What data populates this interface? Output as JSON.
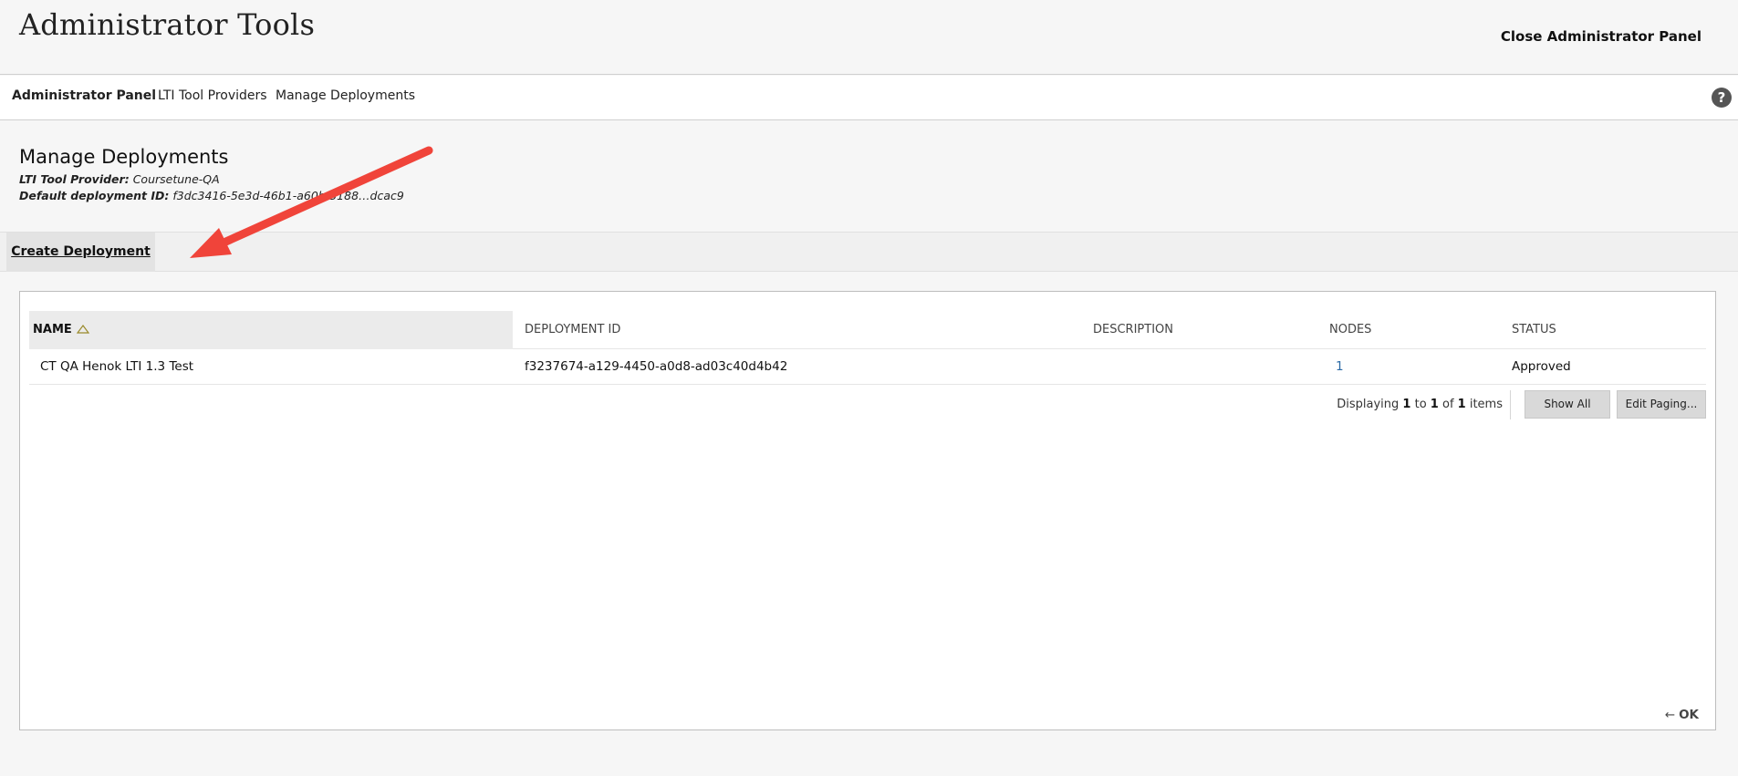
{
  "header": {
    "title": "Administrator Tools",
    "close_label": "Close Administrator Panel"
  },
  "breadcrumb": {
    "items": [
      {
        "label": "Administrator Panel"
      },
      {
        "label": "LTI Tool Providers"
      },
      {
        "label": "Manage Deployments"
      }
    ],
    "help_glyph": "?"
  },
  "section": {
    "title": "Manage Deployments",
    "provider_label": "LTI Tool Provider:",
    "provider_value": "Coursetune-QA",
    "default_id_label": "Default deployment ID:",
    "default_id_value": "f3dc3416-5e3d-46b1-a60b-5188…dcac9"
  },
  "actions": {
    "create_label": "Create Deployment"
  },
  "table": {
    "columns": [
      "NAME",
      "DEPLOYMENT ID",
      "DESCRIPTION",
      "NODES",
      "STATUS"
    ],
    "sort_column": "NAME",
    "sort_icon": "sort-ascending-icon",
    "rows": [
      {
        "name": "CT QA Henok LTI 1.3 Test",
        "deployment_id": "f3237674-a129-4450-a0d8-ad03c40d4b42",
        "description": "",
        "nodes": "1",
        "status": "Approved"
      }
    ]
  },
  "paging": {
    "prefix": "Displaying",
    "from": "1",
    "to_word": "to",
    "to": "1",
    "of_word": "of",
    "total": "1",
    "suffix": "items",
    "show_all_label": "Show All",
    "edit_paging_label": "Edit Paging..."
  },
  "footer": {
    "ok_arrow": "←",
    "ok_label": "OK"
  },
  "colors": {
    "annotation_arrow": "#f0443a",
    "link": "#2b6aa6"
  }
}
